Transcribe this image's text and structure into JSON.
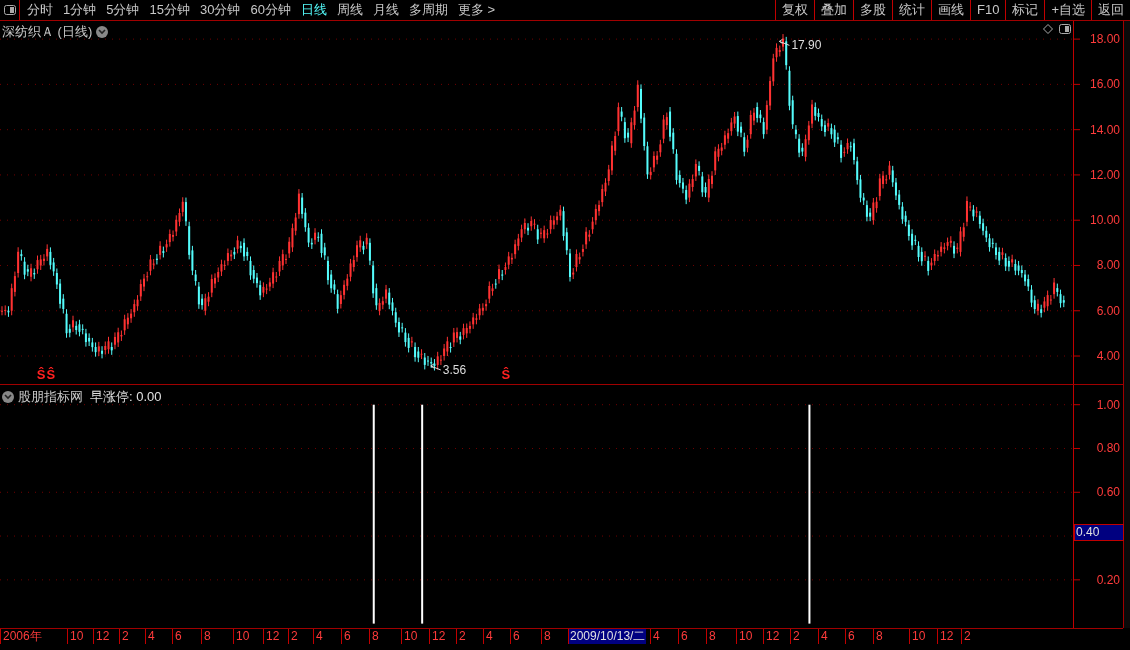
{
  "toolbar": {
    "periods": [
      {
        "label": "分时",
        "selected": false
      },
      {
        "label": "1分钟",
        "selected": false
      },
      {
        "label": "5分钟",
        "selected": false
      },
      {
        "label": "15分钟",
        "selected": false
      },
      {
        "label": "30分钟",
        "selected": false
      },
      {
        "label": "60分钟",
        "selected": false
      },
      {
        "label": "日线",
        "selected": true
      },
      {
        "label": "周线",
        "selected": false
      },
      {
        "label": "月线",
        "selected": false
      },
      {
        "label": "多周期",
        "selected": false
      },
      {
        "label": "更多 >",
        "selected": false
      }
    ],
    "buttons": [
      "复权",
      "叠加",
      "多股",
      "统计",
      "画线",
      "F10",
      "标记",
      "+自选",
      "返回"
    ]
  },
  "price_panel": {
    "title": "深纺织Ａ (日线)",
    "axis_labels": [
      "18.00",
      "16.00",
      "14.00",
      "12.00",
      "10.00",
      "8.00",
      "6.00",
      "4.00"
    ],
    "high_label": "17.90",
    "low_label": "3.56",
    "signals": [
      "Ŝ",
      "Ŝ",
      "Ŝ"
    ]
  },
  "indicator_panel": {
    "name": "股朋指标网",
    "reading": "早涨停: 0.00",
    "axis_labels": [
      "1.00",
      "0.80",
      "0.60",
      "0.20"
    ],
    "cursor_value": "0.40"
  },
  "date_axis": [
    {
      "text": "2006年",
      "kind": "year"
    },
    {
      "text": "10",
      "kind": "month"
    },
    {
      "text": "12",
      "kind": "month"
    },
    {
      "text": "2",
      "kind": "month"
    },
    {
      "text": "4",
      "kind": "month"
    },
    {
      "text": "6",
      "kind": "month"
    },
    {
      "text": "8",
      "kind": "month"
    },
    {
      "text": "10",
      "kind": "month"
    },
    {
      "text": "12",
      "kind": "month"
    },
    {
      "text": "2",
      "kind": "month"
    },
    {
      "text": "4",
      "kind": "month"
    },
    {
      "text": "6",
      "kind": "month"
    },
    {
      "text": "8",
      "kind": "month"
    },
    {
      "text": "10",
      "kind": "month"
    },
    {
      "text": "12",
      "kind": "month"
    },
    {
      "text": "2",
      "kind": "month"
    },
    {
      "text": "4",
      "kind": "month"
    },
    {
      "text": "6",
      "kind": "month"
    },
    {
      "text": "8",
      "kind": "month"
    },
    {
      "text": "2009/10/13/二",
      "kind": "cursor"
    },
    {
      "text": "4",
      "kind": "month"
    },
    {
      "text": "6",
      "kind": "month"
    },
    {
      "text": "8",
      "kind": "month"
    },
    {
      "text": "10",
      "kind": "month"
    },
    {
      "text": "12",
      "kind": "month"
    },
    {
      "text": "2",
      "kind": "month"
    },
    {
      "text": "4",
      "kind": "month"
    },
    {
      "text": "6",
      "kind": "month"
    },
    {
      "text": "8",
      "kind": "month"
    },
    {
      "text": "10",
      "kind": "month"
    },
    {
      "text": "12",
      "kind": "month"
    },
    {
      "text": "2",
      "kind": "month"
    }
  ]
}
